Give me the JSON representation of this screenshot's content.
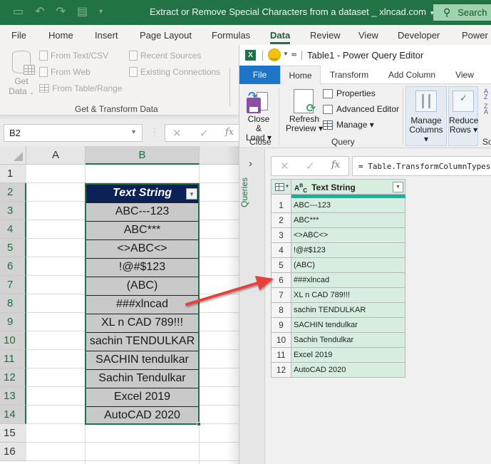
{
  "excel": {
    "title": "Extract or Remove Special Characters from a dataset _ xlncad.com",
    "search_label": "Search",
    "quick_access": [
      "save-icon",
      "undo-icon",
      "redo-icon",
      "form-icon",
      "customize-qat-icon"
    ],
    "tabs": [
      "File",
      "Home",
      "Insert",
      "Page Layout",
      "Formulas",
      "Data",
      "Review",
      "View",
      "Developer",
      "Power"
    ],
    "active_tab": "Data",
    "ribbon": {
      "get_data_label_1": "Get",
      "get_data_label_2": "Data",
      "items": [
        "From Text/CSV",
        "From Web",
        "From Table/Range",
        "Recent Sources",
        "Existing Connections"
      ],
      "group_label": "Get & Transform Data"
    },
    "name_box": "B2",
    "formula_icons": [
      "✕",
      "✓",
      "fx"
    ],
    "columns": [
      "A",
      "B"
    ],
    "rows": [
      "1",
      "2",
      "3",
      "4",
      "5",
      "6",
      "7",
      "8",
      "9",
      "10",
      "11",
      "12",
      "13",
      "14",
      "15",
      "16"
    ],
    "table": {
      "header": "Text String",
      "values": [
        "ABC---123",
        "ABC***",
        "<>ABC<>",
        "!@#$123",
        "(ABC)",
        "###xlncad",
        "XL n CAD 789!!!",
        "sachin TENDULKAR",
        "SACHIN tendulkar",
        "Sachin Tendulkar",
        "Excel 2019",
        "AutoCAD 2020"
      ]
    }
  },
  "power_query": {
    "title": "Table1 - Power Query Editor",
    "tabs": [
      "File",
      "Home",
      "Transform",
      "Add Column",
      "View"
    ],
    "active_tab": "Home",
    "ribbon": {
      "close_load_1": "Close &",
      "close_load_2": "Load ▾",
      "close_group": "Close",
      "refresh_1": "Refresh",
      "refresh_2": "Preview ▾",
      "properties": "Properties",
      "advanced_editor": "Advanced Editor",
      "manage": "Manage ▾",
      "query_group": "Query",
      "manage_columns_1": "Manage",
      "manage_columns_2": "Columns ▾",
      "reduce_rows_1": "Reduce",
      "reduce_rows_2": "Rows ▾",
      "sort_group": "So"
    },
    "queries_label": "Queries",
    "formula": "= Table.TransformColumnTypes(",
    "column_header": "Text String",
    "column_type": "ABC",
    "rows": [
      {
        "n": "1",
        "v": "ABC---123"
      },
      {
        "n": "2",
        "v": "ABC***"
      },
      {
        "n": "3",
        "v": "<>ABC<>"
      },
      {
        "n": "4",
        "v": "!@#$123"
      },
      {
        "n": "5",
        "v": "(ABC)"
      },
      {
        "n": "6",
        "v": "###xlncad"
      },
      {
        "n": "7",
        "v": "XL n CAD 789!!!"
      },
      {
        "n": "8",
        "v": "sachin TENDULKAR"
      },
      {
        "n": "9",
        "v": "SACHIN tendulkar"
      },
      {
        "n": "10",
        "v": "Sachin Tendulkar"
      },
      {
        "n": "11",
        "v": "Excel 2019"
      },
      {
        "n": "12",
        "v": "AutoCAD 2020"
      }
    ]
  },
  "colors": {
    "excel_green": "#217346",
    "table_header": "#0b2158",
    "table_cell": "#c9c9c9",
    "pq_file_tab": "#1e74c6",
    "pq_cell": "#d6ede0",
    "pq_quality_bar": "#0fb59d",
    "arrow": "#e8413e"
  }
}
